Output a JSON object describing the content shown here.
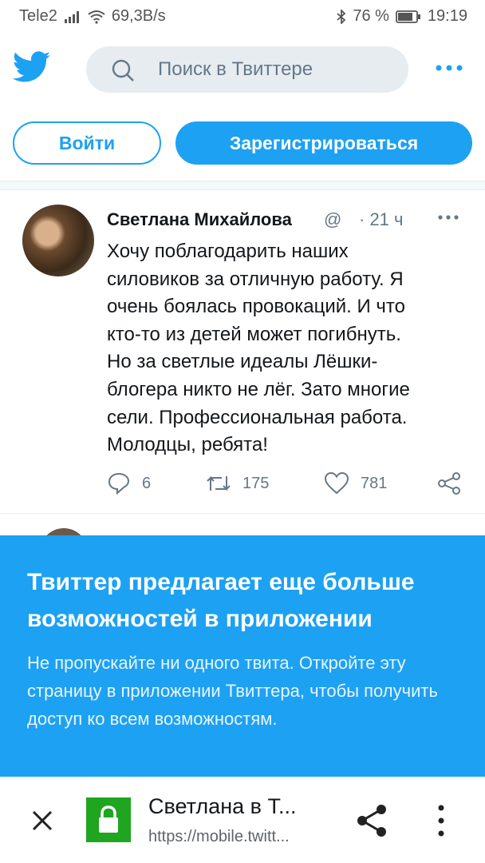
{
  "status": {
    "carrier": "Tele2",
    "speed": "69,3B/s",
    "battery": "76 %",
    "time": "19:19"
  },
  "colors": {
    "brand": "#1da1f2",
    "lock_green": "#1fa51f"
  },
  "header": {
    "search_placeholder": "Поиск в Твиттере",
    "icons": [
      "twitter-bird-icon",
      "search-icon",
      "more-icon"
    ]
  },
  "auth": {
    "login": "Войти",
    "signup": "Зарегистрироваться"
  },
  "tweet": {
    "author": "Светлана Михайлова",
    "handle": "@",
    "time": "· 21 ч",
    "text": "Хочу поблагодарить наших\nсиловиков за отличную работу. Я\nочень боялась провокаций. И что\nкто-то из детей может погибнуть.\nНо за светлые идеалы Лёшки-\nблогера никто не лёг. Зато многие\nсели. Профессиональная работа.\nМолодцы, ребята!",
    "replies": "6",
    "retweets": "175",
    "likes": "781"
  },
  "banner": {
    "title": "Твиттер предлагает еще больше возможностей в приложении",
    "text": "Не пропускайте ни одного твита. Откройте эту страницу в приложении Твиттера, чтобы получить доступ ко всем возможностям."
  },
  "browser": {
    "title": "Светлана в Т...",
    "url": "https://mobile.twitt..."
  }
}
